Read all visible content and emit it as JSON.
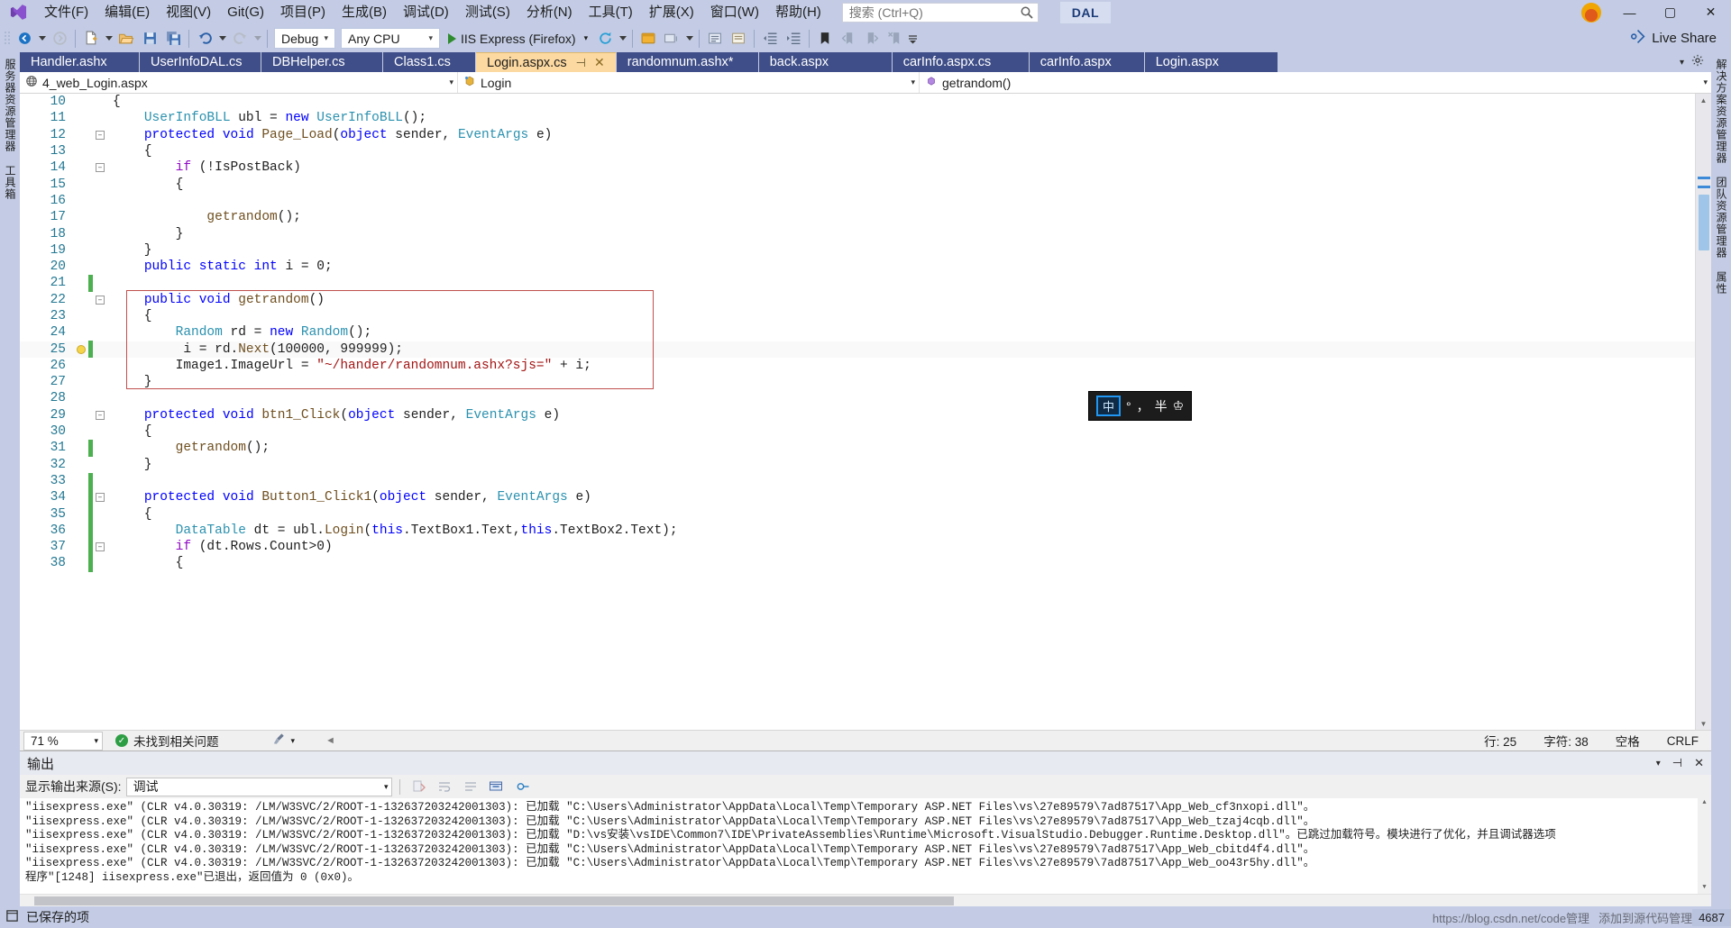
{
  "app": {
    "title": "DAL",
    "logo_name": "visual-studio-logo"
  },
  "menu": {
    "items": [
      {
        "label": "文件(F)"
      },
      {
        "label": "编辑(E)"
      },
      {
        "label": "视图(V)"
      },
      {
        "label": "Git(G)"
      },
      {
        "label": "项目(P)"
      },
      {
        "label": "生成(B)"
      },
      {
        "label": "调试(D)"
      },
      {
        "label": "测试(S)"
      },
      {
        "label": "分析(N)"
      },
      {
        "label": "工具(T)"
      },
      {
        "label": "扩展(X)"
      },
      {
        "label": "窗口(W)"
      },
      {
        "label": "帮助(H)"
      }
    ]
  },
  "search": {
    "placeholder": "搜索 (Ctrl+Q)",
    "value": ""
  },
  "window_controls": {
    "minimize": "—",
    "maximize": "▢",
    "close": "✕"
  },
  "toolbar": {
    "configuration": "Debug",
    "platform": "Any CPU",
    "run_target": "IIS Express (Firefox)",
    "live_share": "Live Share"
  },
  "tabs": {
    "items": [
      {
        "label": "Handler.ashx",
        "active": false,
        "modified": false
      },
      {
        "label": "UserInfoDAL.cs",
        "active": false,
        "modified": false
      },
      {
        "label": "DBHelper.cs",
        "active": false,
        "modified": false
      },
      {
        "label": "Class1.cs",
        "active": false,
        "modified": false
      },
      {
        "label": "Login.aspx.cs",
        "active": true,
        "modified": false
      },
      {
        "label": "randomnum.ashx*",
        "active": false,
        "modified": true
      },
      {
        "label": "back.aspx",
        "active": false,
        "modified": false
      },
      {
        "label": "carInfo.aspx.cs",
        "active": false,
        "modified": false
      },
      {
        "label": "carInfo.aspx",
        "active": false,
        "modified": false
      },
      {
        "label": "Login.aspx",
        "active": false,
        "modified": false
      }
    ]
  },
  "navbar": {
    "project": "4_web_Login.aspx",
    "type": "Login",
    "member": "getrandom()"
  },
  "editor": {
    "language": "csharp",
    "first_line": 10,
    "lines": [
      {
        "num": 10,
        "indent": 0,
        "change": "none",
        "glyph": "",
        "tokens": [
          {
            "t": "{",
            "c": "n"
          }
        ]
      },
      {
        "num": 11,
        "indent": 0,
        "change": "none",
        "glyph": "",
        "tokens": [
          {
            "t": "    ",
            "c": "n"
          },
          {
            "t": "UserInfoBLL",
            "c": "kc"
          },
          {
            "t": " ubl ",
            "c": "n"
          },
          {
            "t": "= ",
            "c": "n"
          },
          {
            "t": "new",
            "c": "k"
          },
          {
            "t": " ",
            "c": "n"
          },
          {
            "t": "UserInfoBLL",
            "c": "kc"
          },
          {
            "t": "();",
            "c": "n"
          }
        ]
      },
      {
        "num": 12,
        "indent": 0,
        "change": "none",
        "glyph": "collapse",
        "tokens": [
          {
            "t": "    ",
            "c": "n"
          },
          {
            "t": "protected",
            "c": "k"
          },
          {
            "t": " ",
            "c": "n"
          },
          {
            "t": "void",
            "c": "k"
          },
          {
            "t": " ",
            "c": "n"
          },
          {
            "t": "Page_Load",
            "c": "mth"
          },
          {
            "t": "(",
            "c": "n"
          },
          {
            "t": "object",
            "c": "k"
          },
          {
            "t": " sender, ",
            "c": "n"
          },
          {
            "t": "EventArgs",
            "c": "kc"
          },
          {
            "t": " e)",
            "c": "n"
          }
        ]
      },
      {
        "num": 13,
        "indent": 0,
        "change": "none",
        "glyph": "",
        "tokens": [
          {
            "t": "    {",
            "c": "n"
          }
        ]
      },
      {
        "num": 14,
        "indent": 0,
        "change": "none",
        "glyph": "collapse",
        "tokens": [
          {
            "t": "        ",
            "c": "n"
          },
          {
            "t": "if",
            "c": "kp"
          },
          {
            "t": " (!IsPostBack)",
            "c": "n"
          }
        ]
      },
      {
        "num": 15,
        "indent": 0,
        "change": "none",
        "glyph": "",
        "tokens": [
          {
            "t": "        {",
            "c": "n"
          }
        ]
      },
      {
        "num": 16,
        "indent": 0,
        "change": "none",
        "glyph": "",
        "tokens": [
          {
            "t": "",
            "c": "n"
          }
        ]
      },
      {
        "num": 17,
        "indent": 0,
        "change": "none",
        "glyph": "",
        "tokens": [
          {
            "t": "            ",
            "c": "n"
          },
          {
            "t": "getrandom",
            "c": "mth"
          },
          {
            "t": "();",
            "c": "n"
          }
        ]
      },
      {
        "num": 18,
        "indent": 0,
        "change": "none",
        "glyph": "",
        "tokens": [
          {
            "t": "        }",
            "c": "n"
          }
        ]
      },
      {
        "num": 19,
        "indent": 0,
        "change": "none",
        "glyph": "",
        "tokens": [
          {
            "t": "    }",
            "c": "n"
          }
        ]
      },
      {
        "num": 20,
        "indent": 0,
        "change": "none",
        "glyph": "",
        "tokens": [
          {
            "t": "    ",
            "c": "n"
          },
          {
            "t": "public",
            "c": "k"
          },
          {
            "t": " ",
            "c": "n"
          },
          {
            "t": "static",
            "c": "k"
          },
          {
            "t": " ",
            "c": "n"
          },
          {
            "t": "int",
            "c": "k"
          },
          {
            "t": " i = ",
            "c": "n"
          },
          {
            "t": "0",
            "c": "num"
          },
          {
            "t": ";",
            "c": "n"
          }
        ]
      },
      {
        "num": 21,
        "indent": 0,
        "change": "green",
        "glyph": "",
        "tokens": [
          {
            "t": "",
            "c": "n"
          }
        ]
      },
      {
        "num": 22,
        "indent": 0,
        "change": "none",
        "glyph": "collapse",
        "tokens": [
          {
            "t": "    ",
            "c": "n"
          },
          {
            "t": "public",
            "c": "k"
          },
          {
            "t": " ",
            "c": "n"
          },
          {
            "t": "void",
            "c": "k"
          },
          {
            "t": " ",
            "c": "n"
          },
          {
            "t": "getrandom",
            "c": "mth"
          },
          {
            "t": "()",
            "c": "n"
          }
        ]
      },
      {
        "num": 23,
        "indent": 0,
        "change": "none",
        "glyph": "",
        "tokens": [
          {
            "t": "    {",
            "c": "n"
          }
        ]
      },
      {
        "num": 24,
        "indent": 0,
        "change": "none",
        "glyph": "",
        "tokens": [
          {
            "t": "        ",
            "c": "n"
          },
          {
            "t": "Random",
            "c": "kc"
          },
          {
            "t": " rd = ",
            "c": "n"
          },
          {
            "t": "new",
            "c": "k"
          },
          {
            "t": " ",
            "c": "n"
          },
          {
            "t": "Random",
            "c": "kc"
          },
          {
            "t": "();",
            "c": "n"
          }
        ]
      },
      {
        "num": 25,
        "indent": 0,
        "change": "green",
        "glyph": "bulb",
        "tokens": [
          {
            "t": "         i = rd.",
            "c": "n"
          },
          {
            "t": "Next",
            "c": "mth"
          },
          {
            "t": "(",
            "c": "n"
          },
          {
            "t": "100000",
            "c": "num"
          },
          {
            "t": ", ",
            "c": "n"
          },
          {
            "t": "999999",
            "c": "num"
          },
          {
            "t": ");",
            "c": "n"
          }
        ]
      },
      {
        "num": 26,
        "indent": 0,
        "change": "none",
        "glyph": "",
        "tokens": [
          {
            "t": "        Image1.ImageUrl = ",
            "c": "n"
          },
          {
            "t": "\"~/hander/randomnum.ashx?sjs=\"",
            "c": "s"
          },
          {
            "t": " + i;",
            "c": "n"
          }
        ]
      },
      {
        "num": 27,
        "indent": 0,
        "change": "none",
        "glyph": "",
        "tokens": [
          {
            "t": "    }",
            "c": "n"
          }
        ]
      },
      {
        "num": 28,
        "indent": 0,
        "change": "none",
        "glyph": "",
        "tokens": [
          {
            "t": "",
            "c": "n"
          }
        ]
      },
      {
        "num": 29,
        "indent": 0,
        "change": "none",
        "glyph": "collapse",
        "tokens": [
          {
            "t": "    ",
            "c": "n"
          },
          {
            "t": "protected",
            "c": "k"
          },
          {
            "t": " ",
            "c": "n"
          },
          {
            "t": "void",
            "c": "k"
          },
          {
            "t": " ",
            "c": "n"
          },
          {
            "t": "btn1_Click",
            "c": "mth"
          },
          {
            "t": "(",
            "c": "n"
          },
          {
            "t": "object",
            "c": "k"
          },
          {
            "t": " sender, ",
            "c": "n"
          },
          {
            "t": "EventArgs",
            "c": "kc"
          },
          {
            "t": " e)",
            "c": "n"
          }
        ]
      },
      {
        "num": 30,
        "indent": 0,
        "change": "none",
        "glyph": "",
        "tokens": [
          {
            "t": "    {",
            "c": "n"
          }
        ]
      },
      {
        "num": 31,
        "indent": 0,
        "change": "green",
        "glyph": "",
        "tokens": [
          {
            "t": "        ",
            "c": "n"
          },
          {
            "t": "getrandom",
            "c": "mth"
          },
          {
            "t": "();",
            "c": "n"
          }
        ]
      },
      {
        "num": 32,
        "indent": 0,
        "change": "none",
        "glyph": "",
        "tokens": [
          {
            "t": "    }",
            "c": "n"
          }
        ]
      },
      {
        "num": 33,
        "indent": 0,
        "change": "green",
        "glyph": "",
        "tokens": [
          {
            "t": "",
            "c": "n"
          }
        ]
      },
      {
        "num": 34,
        "indent": 0,
        "change": "green",
        "glyph": "collapse",
        "tokens": [
          {
            "t": "    ",
            "c": "n"
          },
          {
            "t": "protected",
            "c": "k"
          },
          {
            "t": " ",
            "c": "n"
          },
          {
            "t": "void",
            "c": "k"
          },
          {
            "t": " ",
            "c": "n"
          },
          {
            "t": "Button1_Click1",
            "c": "mth"
          },
          {
            "t": "(",
            "c": "n"
          },
          {
            "t": "object",
            "c": "k"
          },
          {
            "t": " sender, ",
            "c": "n"
          },
          {
            "t": "EventArgs",
            "c": "kc"
          },
          {
            "t": " e)",
            "c": "n"
          }
        ]
      },
      {
        "num": 35,
        "indent": 0,
        "change": "green",
        "glyph": "",
        "tokens": [
          {
            "t": "    {",
            "c": "n"
          }
        ]
      },
      {
        "num": 36,
        "indent": 0,
        "change": "green",
        "glyph": "",
        "tokens": [
          {
            "t": "        ",
            "c": "n"
          },
          {
            "t": "DataTable",
            "c": "kc"
          },
          {
            "t": " dt = ubl.",
            "c": "n"
          },
          {
            "t": "Login",
            "c": "mth"
          },
          {
            "t": "(",
            "c": "n"
          },
          {
            "t": "this",
            "c": "k"
          },
          {
            "t": ".TextBox1.Text,",
            "c": "n"
          },
          {
            "t": "this",
            "c": "k"
          },
          {
            "t": ".TextBox2.Text);",
            "c": "n"
          }
        ]
      },
      {
        "num": 37,
        "indent": 0,
        "change": "green",
        "glyph": "collapse",
        "tokens": [
          {
            "t": "        ",
            "c": "n"
          },
          {
            "t": "if",
            "c": "kp"
          },
          {
            "t": " (dt.Rows.Count>",
            "c": "n"
          },
          {
            "t": "0",
            "c": "num"
          },
          {
            "t": ")",
            "c": "n"
          }
        ]
      },
      {
        "num": 38,
        "indent": 0,
        "change": "green",
        "glyph": "",
        "tokens": [
          {
            "t": "        {",
            "c": "n"
          }
        ]
      }
    ]
  },
  "tooltip": {
    "chip": "中",
    "items": [
      "°",
      "，",
      "半",
      "♔"
    ]
  },
  "editor_status": {
    "zoom": "71 %",
    "issues": "未找到相关问题",
    "line": "行: 25",
    "column": "字符: 38",
    "spaces": "空格",
    "eol": "CRLF"
  },
  "output": {
    "title": "输出",
    "source_label": "显示输出来源(S):",
    "source_value": "调试",
    "lines": [
      "\"iisexpress.exe\" (CLR v4.0.30319: /LM/W3SVC/2/ROOT-1-132637203242001303): 已加载 \"C:\\Users\\Administrator\\AppData\\Local\\Temp\\Temporary ASP.NET Files\\vs\\27e89579\\7ad87517\\App_Web_cf3nxopi.dll\"。",
      "\"iisexpress.exe\" (CLR v4.0.30319: /LM/W3SVC/2/ROOT-1-132637203242001303): 已加载 \"C:\\Users\\Administrator\\AppData\\Local\\Temp\\Temporary ASP.NET Files\\vs\\27e89579\\7ad87517\\App_Web_tzaj4cqb.dll\"。",
      "\"iisexpress.exe\" (CLR v4.0.30319: /LM/W3SVC/2/ROOT-1-132637203242001303): 已加载 \"D:\\vs安装\\vsIDE\\Common7\\IDE\\PrivateAssemblies\\Runtime\\Microsoft.VisualStudio.Debugger.Runtime.Desktop.dll\"。已跳过加载符号。模块进行了优化，并且调试器选项",
      "\"iisexpress.exe\" (CLR v4.0.30319: /LM/W3SVC/2/ROOT-1-132637203242001303): 已加载 \"C:\\Users\\Administrator\\AppData\\Local\\Temp\\Temporary ASP.NET Files\\vs\\27e89579\\7ad87517\\App_Web_cbitd4f4.dll\"。",
      "\"iisexpress.exe\" (CLR v4.0.30319: /LM/W3SVC/2/ROOT-1-132637203242001303): 已加载 \"C:\\Users\\Administrator\\AppData\\Local\\Temp\\Temporary ASP.NET Files\\vs\\27e89579\\7ad87517\\App_Web_oo43r5hy.dll\"。",
      "程序\"[1248] iisexpress.exe\"已退出，返回值为 0 (0x0)。"
    ]
  },
  "statusbar": {
    "saved": "已保存的项",
    "watermark": "https://blog.csdn.net/code管理",
    "watermark2": "添加到源代码管理",
    "clock": "4687"
  },
  "left_rail": {
    "items": [
      "服务器资源管理器",
      "工具箱"
    ]
  },
  "right_rail": {
    "items": [
      "属性",
      "团队资源管理器",
      "解决方案资源管理器"
    ]
  },
  "colors": {
    "chrome": "#c3cce4",
    "tab_inactive": "#3f4e88",
    "tab_active": "#fcd9a0",
    "accent_red_box": "#c0504d",
    "change_green": "#4caf50"
  }
}
